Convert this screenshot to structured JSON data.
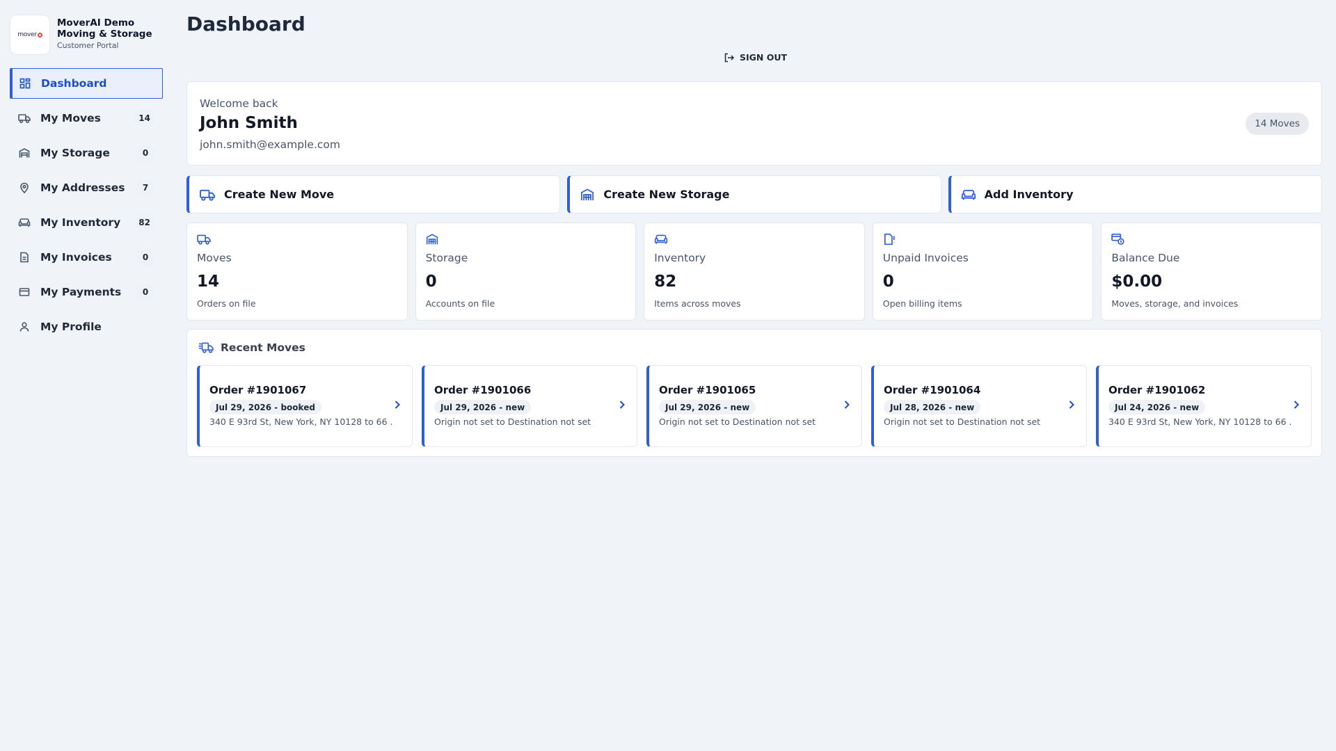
{
  "brand": {
    "logo_text": "mover",
    "name": "MoverAI Demo Moving & Storage",
    "subtitle": "Customer Portal"
  },
  "sidebar": {
    "items": [
      {
        "label": "Dashboard",
        "icon": "dashboard-icon",
        "badge": "",
        "active": true
      },
      {
        "label": "My Moves",
        "icon": "truck-icon",
        "badge": "14"
      },
      {
        "label": "My Storage",
        "icon": "warehouse-icon",
        "badge": "0"
      },
      {
        "label": "My Addresses",
        "icon": "map-pin-icon",
        "badge": "7"
      },
      {
        "label": "My Inventory",
        "icon": "sofa-icon",
        "badge": "82"
      },
      {
        "label": "My Invoices",
        "icon": "invoice-icon",
        "badge": "0"
      },
      {
        "label": "My Payments",
        "icon": "credit-card-icon",
        "badge": "0"
      },
      {
        "label": "My Profile",
        "icon": "user-icon",
        "badge": ""
      }
    ]
  },
  "header": {
    "title": "Dashboard",
    "signout_label": "SIGN OUT"
  },
  "welcome": {
    "greeting": "Welcome back",
    "name": "John Smith",
    "email": "john.smith@example.com",
    "moves_pill": "14 Moves"
  },
  "actions": [
    {
      "label": "Create New Move",
      "icon": "truck-icon"
    },
    {
      "label": "Create New Storage",
      "icon": "warehouse-icon"
    },
    {
      "label": "Add Inventory",
      "icon": "sofa-icon"
    }
  ],
  "stats": [
    {
      "title": "Moves",
      "value": "14",
      "sub": "Orders on file",
      "icon": "truck-icon"
    },
    {
      "title": "Storage",
      "value": "0",
      "sub": "Accounts on file",
      "icon": "warehouse-icon"
    },
    {
      "title": "Inventory",
      "value": "82",
      "sub": "Items across moves",
      "icon": "sofa-icon"
    },
    {
      "title": "Unpaid Invoices",
      "value": "0",
      "sub": "Open billing items",
      "icon": "invoice-alert-icon"
    },
    {
      "title": "Balance Due",
      "value": "$0.00",
      "sub": "Moves, storage, and invoices",
      "icon": "balance-icon"
    }
  ],
  "recent": {
    "title": "Recent Moves",
    "orders": [
      {
        "number": "Order #1901067",
        "badge": "Jul 29, 2026 - booked",
        "route": "340 E 93rd St, New York, NY 10128 to 66 ..."
      },
      {
        "number": "Order #1901066",
        "badge": "Jul 29, 2026 - new",
        "route": "Origin not set to Destination not set"
      },
      {
        "number": "Order #1901065",
        "badge": "Jul 29, 2026 - new",
        "route": "Origin not set to Destination not set"
      },
      {
        "number": "Order #1901064",
        "badge": "Jul 28, 2026 - new",
        "route": "Origin not set to Destination not set"
      },
      {
        "number": "Order #1901062",
        "badge": "Jul 24, 2026 - new",
        "route": "340 E 93rd St, New York, NY 10128 to 66 ..."
      }
    ]
  },
  "colors": {
    "accent": "#2f5ed6",
    "background": "#f0f3f7",
    "text": "#111827",
    "muted": "#475569"
  }
}
